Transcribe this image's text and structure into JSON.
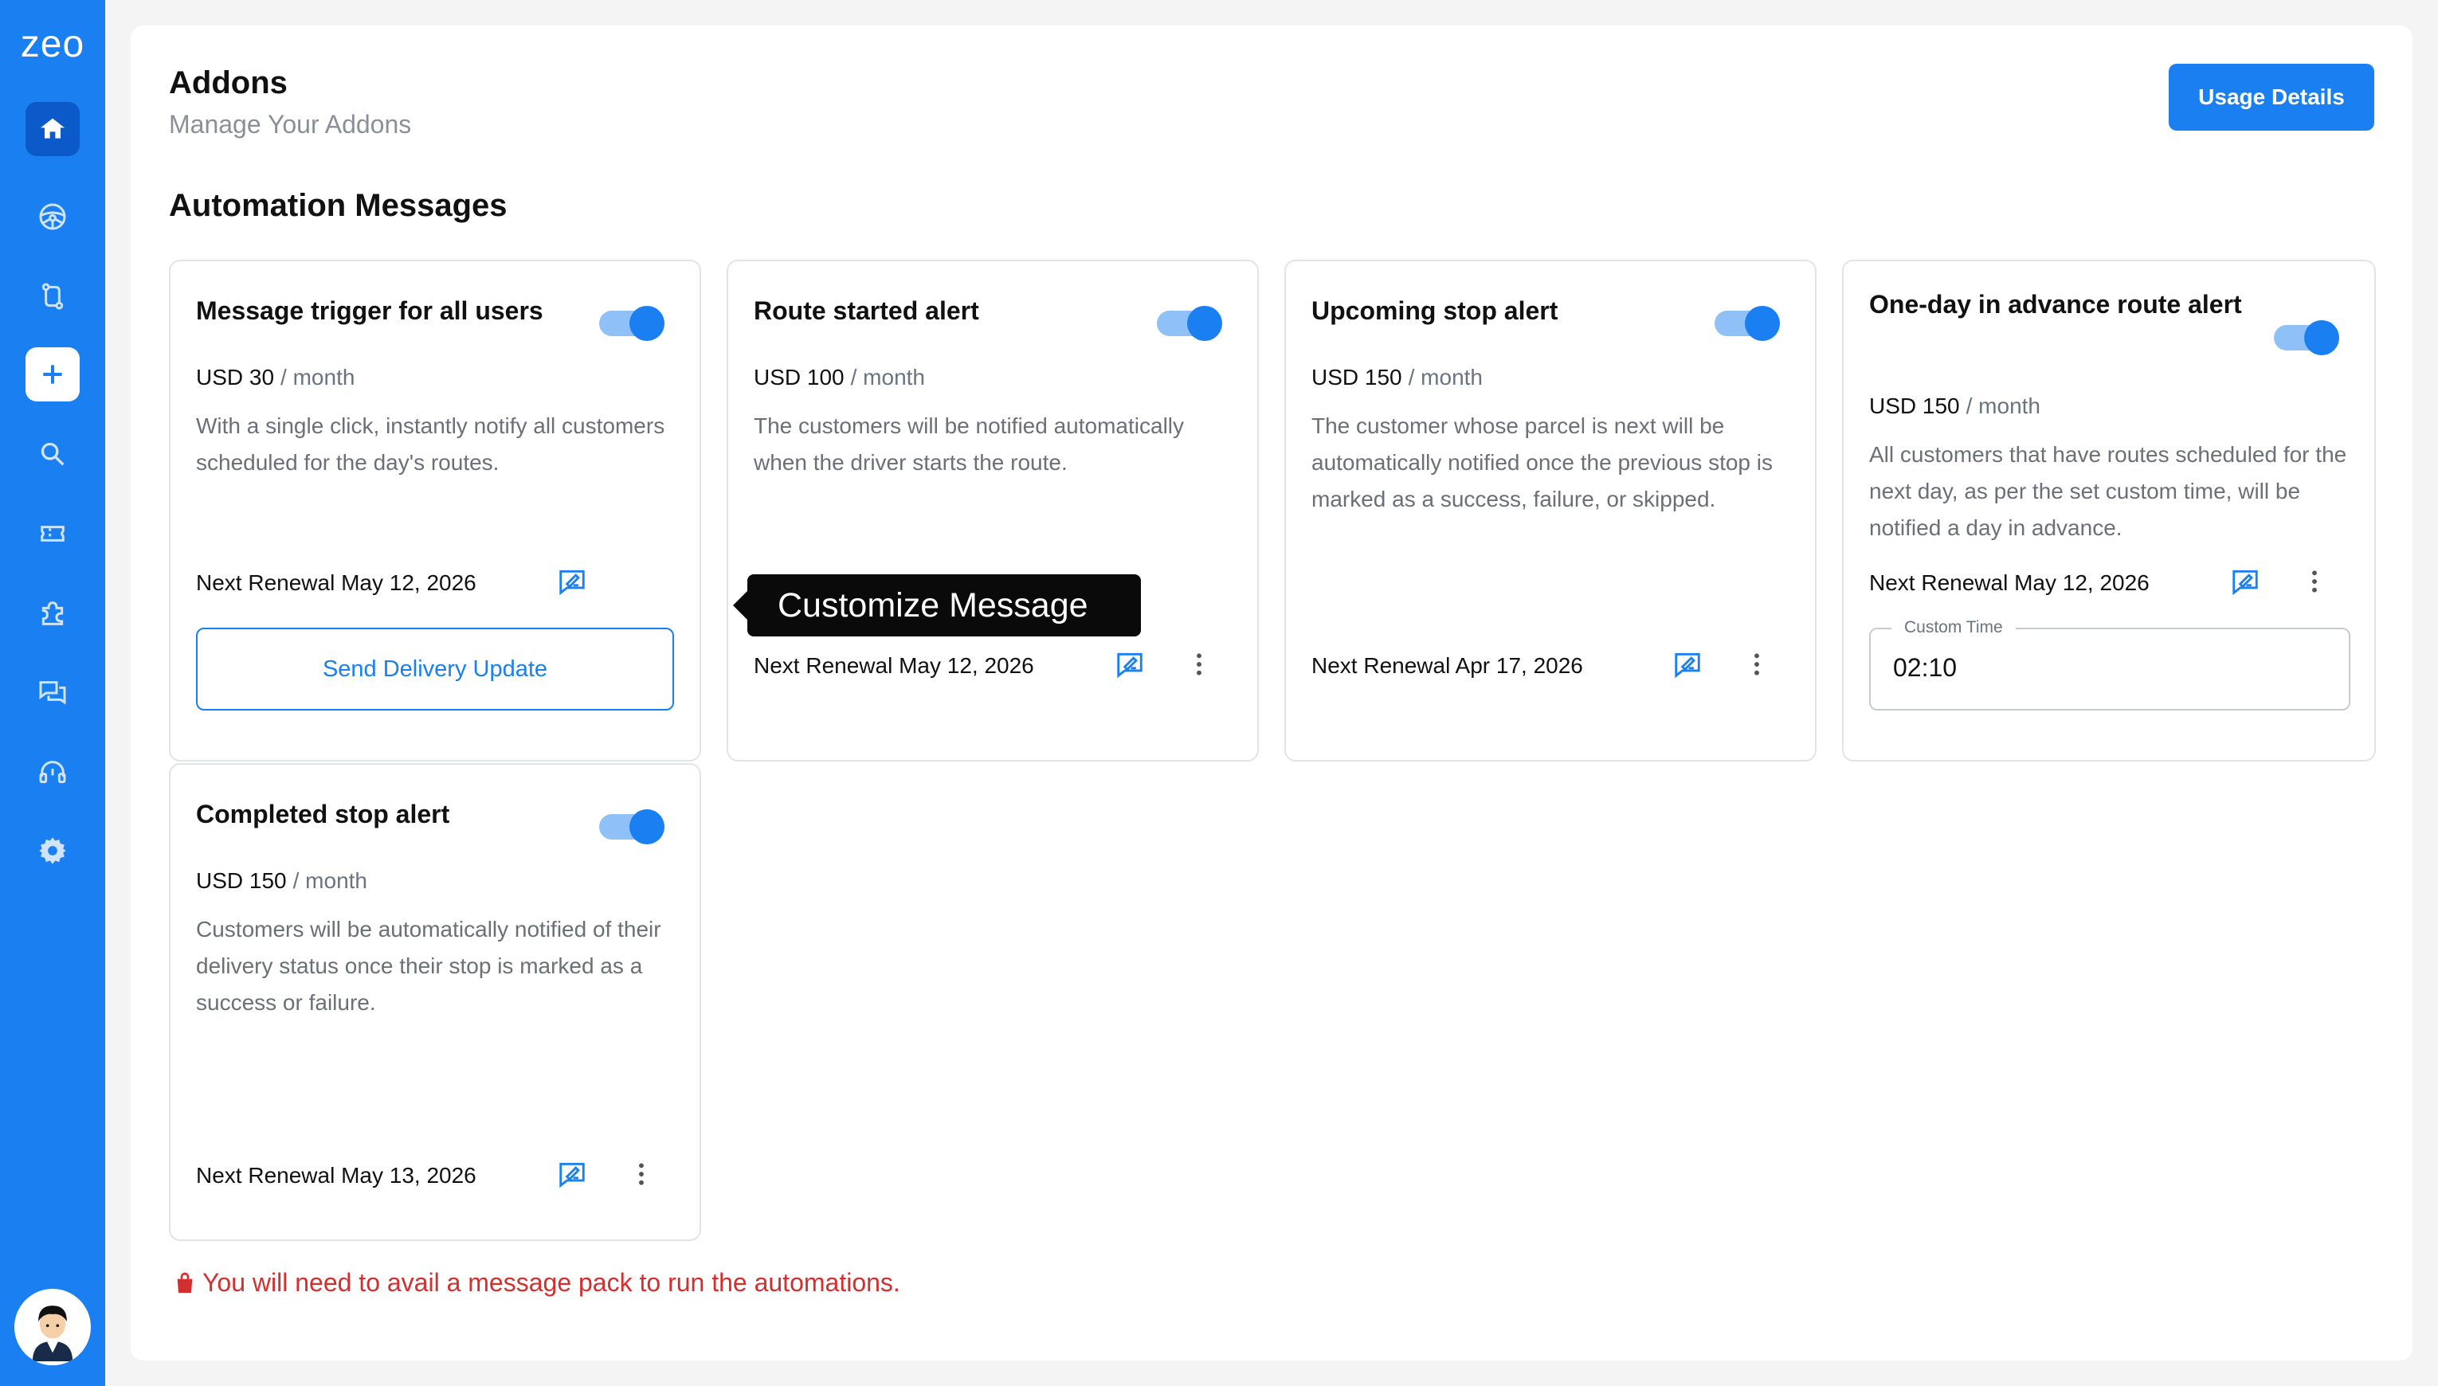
{
  "app": {
    "logo": "zeo"
  },
  "colors": {
    "brand": "#1a7ff0",
    "warning": "#d32f2f"
  },
  "sidebar": {
    "items": [
      {
        "name": "home",
        "icon": "home-icon",
        "active": true
      },
      {
        "name": "drivers",
        "icon": "steering-wheel-icon"
      },
      {
        "name": "routes",
        "icon": "route-icon"
      },
      {
        "name": "add",
        "icon": "plus-icon"
      },
      {
        "name": "search",
        "icon": "search-icon"
      },
      {
        "name": "tickets",
        "icon": "ticket-icon"
      },
      {
        "name": "addons",
        "icon": "puzzle-icon"
      },
      {
        "name": "messages",
        "icon": "chat-icon"
      },
      {
        "name": "support",
        "icon": "headset-icon"
      },
      {
        "name": "settings",
        "icon": "gear-icon"
      }
    ]
  },
  "header": {
    "title": "Addons",
    "subtitle": "Manage Your Addons",
    "usage_button": "Usage Details"
  },
  "section": {
    "title": "Automation Messages"
  },
  "cards": [
    {
      "title": "Message trigger for all users",
      "price": "USD 30",
      "period": "/ month",
      "description": "With a single click, instantly notify all customers scheduled for the day's routes.",
      "renewal": "Next Renewal May 12, 2026",
      "enabled": true,
      "action_button": "Send Delivery Update"
    },
    {
      "title": "Route started alert",
      "price": "USD 100",
      "period": "/ month",
      "description": "The customers will be notified automatically when the driver starts the route.",
      "renewal": "Next Renewal May 12, 2026",
      "enabled": true
    },
    {
      "title": "Upcoming stop alert",
      "price": "USD 150",
      "period": "/ month",
      "description": "The customer whose parcel is next will be automatically notified once the previous stop is marked as a success, failure, or skipped.",
      "renewal": "Next Renewal Apr 17, 2026",
      "enabled": true
    },
    {
      "title": "One-day in advance route alert",
      "price": "USD 150",
      "period": "/ month",
      "description": "All customers that have routes scheduled for the next day, as per the set custom time, will be notified a day in advance.",
      "renewal": "Next Renewal May 12, 2026",
      "enabled": true,
      "custom_time_label": "Custom Time",
      "custom_time_value": "02:10"
    },
    {
      "title": "Completed stop alert",
      "price": "USD 150",
      "period": "/ month",
      "description": "Customers will be automatically notified of their delivery status once their stop is marked as a success or failure.",
      "renewal": "Next Renewal May 13, 2026",
      "enabled": true
    }
  ],
  "tooltip": {
    "text": "Customize Message"
  },
  "warning": {
    "text": "You will need to avail a message pack to run the automations."
  }
}
